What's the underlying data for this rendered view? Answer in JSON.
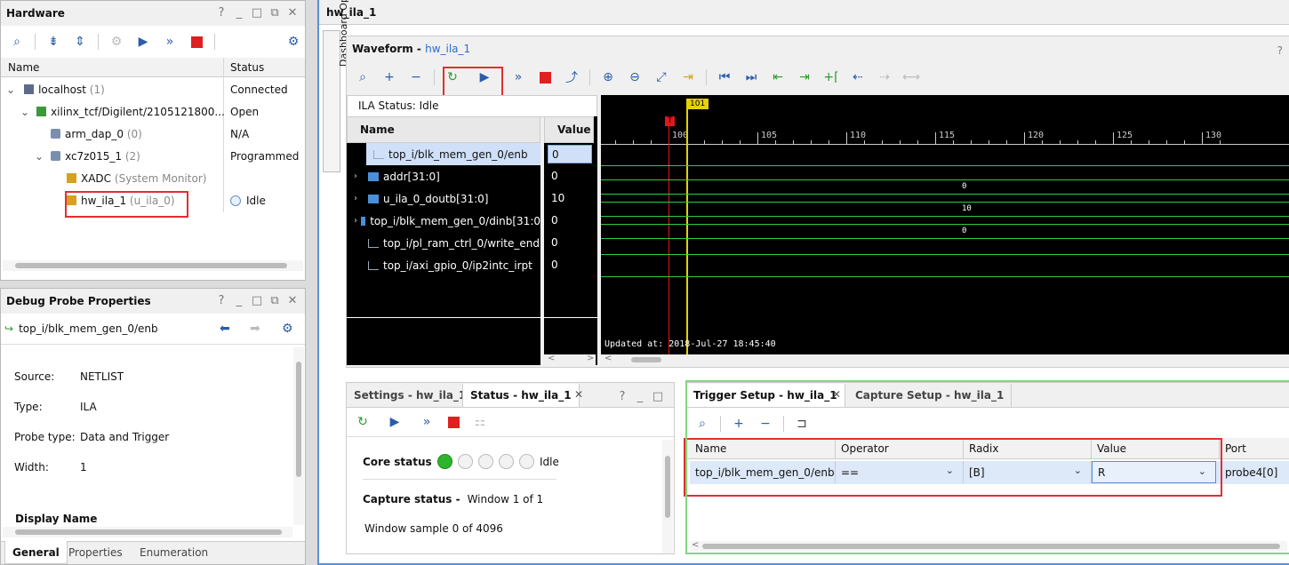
{
  "hardware": {
    "title": "Hardware",
    "window_buttons": [
      "?",
      "_",
      "□",
      "⧉",
      "✕"
    ],
    "columns": {
      "name": "Name",
      "status": "Status"
    },
    "rows": [
      {
        "label": "localhost",
        "suffix": "(1)",
        "status": "Connected"
      },
      {
        "label": "xilinx_tcf/Digilent/2105121800...",
        "suffix": "",
        "status": "Open"
      },
      {
        "label": "arm_dap_0",
        "suffix": "(0)",
        "status": "N/A"
      },
      {
        "label": "xc7z015_1",
        "suffix": "(2)",
        "status": "Programmed"
      },
      {
        "label": "XADC",
        "suffix": "(System Monitor)",
        "status": ""
      },
      {
        "label": "hw_ila_1",
        "suffix": "(u_ila_0)",
        "status": "Idle"
      }
    ]
  },
  "debug_probe": {
    "title": "Debug Probe Properties",
    "probe": "top_i/blk_mem_gen_0/enb",
    "props": [
      {
        "key": "Source:",
        "value": "NETLIST"
      },
      {
        "key": "Type:",
        "value": "ILA"
      },
      {
        "key": "Probe type:",
        "value": "Data and Trigger"
      },
      {
        "key": "Width:",
        "value": "1"
      }
    ],
    "section": "Display Name",
    "tabs": [
      "General",
      "Properties",
      "Enumeration"
    ]
  },
  "main": {
    "title": "hw_ila_1",
    "side_tab": "Dashboard Options",
    "waveform_label": "Waveform - ",
    "waveform_link": "hw_ila_1",
    "help": "?",
    "ila_status": "ILA Status:  Idle",
    "name_header": "Name",
    "value_header": "Value",
    "signals": [
      {
        "name": "top_i/blk_mem_gen_0/enb",
        "value": "0",
        "bus": false
      },
      {
        "name": "addr[31:0]",
        "value": "0",
        "bus": true
      },
      {
        "name": "u_ila_0_doutb[31:0]",
        "value": "10",
        "bus": true
      },
      {
        "name": "top_i/blk_mem_gen_0/dinb[31:0",
        "value": "0",
        "bus": true
      },
      {
        "name": "top_i/pl_ram_ctrl_0/write_end",
        "value": "0",
        "bus": false
      },
      {
        "name": "top_i/axi_gpio_0/ip2intc_irpt",
        "value": "0",
        "bus": false
      }
    ],
    "cursor_label": "101",
    "trigger_marker": "T",
    "ticks": [
      "100",
      "105",
      "110",
      "115",
      "120",
      "125",
      "130"
    ],
    "bus_values": [
      "0",
      "10",
      "0"
    ],
    "updated": "Updated at: 2018-Jul-27 18:45:40"
  },
  "status_panel": {
    "tabs": [
      "Settings - hw_ila_1",
      "Status - hw_ila_1"
    ],
    "core_status_label": "Core status",
    "core_status_value": "Idle",
    "capture_status_label": "Capture status -",
    "capture_status_value": "Window 1 of 1",
    "window_sample": "Window sample 0 of 4096"
  },
  "trigger_panel": {
    "tabs": [
      "Trigger Setup - hw_ila_1",
      "Capture Setup - hw_ila_1"
    ],
    "columns": [
      "Name",
      "Operator",
      "Radix",
      "Value",
      "Port"
    ],
    "row": {
      "name": "top_i/blk_mem_gen_0/enb",
      "operator": "==",
      "radix": "[B]",
      "value": "R",
      "port": "probe4[0]"
    }
  },
  "colors": {
    "accent_red": "#e03030",
    "accent_green": "#7fd87f",
    "wave_green": "#2ecc40",
    "cursor_yellow": "#e6d200"
  }
}
